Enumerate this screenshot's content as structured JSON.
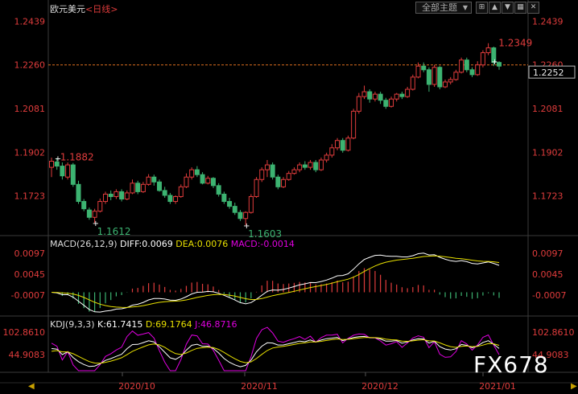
{
  "header": {
    "symbol": "欧元美元",
    "period": "<日线>"
  },
  "toolbar": {
    "indicator_select": "全部主题",
    "btn_settings": "⊞",
    "btn_up": "▲",
    "btn_down": "▼",
    "btn_grid": "▦",
    "btn_close": "✕"
  },
  "price_axis": {
    "left_labels": [
      "1.2439",
      "1.2260",
      "1.2081",
      "1.1902",
      "1.1723"
    ],
    "right_labels": [
      "1.2439",
      "1.2260",
      "1.2081",
      "1.1902",
      "1.1723"
    ],
    "current_price": "1.2252"
  },
  "annotations": {
    "high_left": "1.1882",
    "low_1": "1.1612",
    "low_2": "1.1603",
    "high_right": "1.2349"
  },
  "macd": {
    "title": "MACD(26,12,9)",
    "diff_label": "DIFF:0.0069",
    "dea_label": "DEA:0.0076",
    "macd_label": "MACD:-0.0014",
    "axis_labels": [
      "0.0097",
      "0.0045",
      "-0.0007"
    ]
  },
  "kdj": {
    "title": "KDJ(9,3,3)",
    "k_label": "K:61.7415",
    "d_label": "D:69.1764",
    "j_label": "J:46.8716",
    "axis_labels": [
      "102.8610",
      "44.9083"
    ]
  },
  "date_axis": [
    "2020/10",
    "2020/11",
    "2020/12",
    "2021/01"
  ],
  "watermark": "FX678",
  "nav": {
    "left": "◀",
    "right": "▶"
  },
  "colors": {
    "up": "#e03c3c",
    "down": "#3cb371",
    "diff": "#ffffff",
    "dea": "#e8e000",
    "macd": "#e000e0",
    "k": "#ffffff",
    "d": "#e8e000",
    "j": "#e000e0",
    "axis_text": "#e03c3c",
    "grid": "#5a1a1a"
  },
  "chart_data": {
    "type": "candlestick",
    "title": "欧元美元 <日线>",
    "ylim": [
      1.156,
      1.248
    ],
    "x_ticks": [
      "2020/10",
      "2020/11",
      "2020/12",
      "2021/01"
    ],
    "candles": [
      [
        1.184,
        1.1865,
        1.188,
        1.18
      ],
      [
        1.1862,
        1.1845,
        1.1878,
        1.183
      ],
      [
        1.1845,
        1.1805,
        1.186,
        1.179
      ],
      [
        1.18,
        1.185,
        1.186,
        1.179
      ],
      [
        1.185,
        1.177,
        1.1858,
        1.176
      ],
      [
        1.177,
        1.17,
        1.1785,
        1.169
      ],
      [
        1.17,
        1.167,
        1.171,
        1.166
      ],
      [
        1.1665,
        1.1635,
        1.1675,
        1.1625
      ],
      [
        1.1635,
        1.166,
        1.167,
        1.1612
      ],
      [
        1.166,
        1.17,
        1.1712,
        1.1655
      ],
      [
        1.17,
        1.173,
        1.174,
        1.169
      ],
      [
        1.173,
        1.172,
        1.1745,
        1.1705
      ],
      [
        1.172,
        1.174,
        1.175,
        1.171
      ],
      [
        1.174,
        1.171,
        1.175,
        1.17
      ],
      [
        1.171,
        1.1735,
        1.1745,
        1.1705
      ],
      [
        1.1735,
        1.1775,
        1.179,
        1.173
      ],
      [
        1.1775,
        1.174,
        1.1785,
        1.173
      ],
      [
        1.174,
        1.177,
        1.178,
        1.1735
      ],
      [
        1.177,
        1.18,
        1.1812,
        1.1765
      ],
      [
        1.18,
        1.178,
        1.181,
        1.1765
      ],
      [
        1.178,
        1.1745,
        1.179,
        1.174
      ],
      [
        1.1745,
        1.1725,
        1.176,
        1.1715
      ],
      [
        1.1725,
        1.17,
        1.1735,
        1.169
      ],
      [
        1.17,
        1.172,
        1.1725,
        1.169
      ],
      [
        1.172,
        1.176,
        1.177,
        1.1715
      ],
      [
        1.176,
        1.18,
        1.1815,
        1.1755
      ],
      [
        1.18,
        1.183,
        1.184,
        1.179
      ],
      [
        1.183,
        1.181,
        1.1845,
        1.18
      ],
      [
        1.181,
        1.1775,
        1.182,
        1.177
      ],
      [
        1.1775,
        1.1795,
        1.1805,
        1.177
      ],
      [
        1.1795,
        1.1765,
        1.18,
        1.1755
      ],
      [
        1.1765,
        1.173,
        1.1775,
        1.172
      ],
      [
        1.173,
        1.17,
        1.174,
        1.169
      ],
      [
        1.17,
        1.168,
        1.1715,
        1.167
      ],
      [
        1.168,
        1.1655,
        1.1695,
        1.1645
      ],
      [
        1.1655,
        1.163,
        1.1665,
        1.162
      ],
      [
        1.163,
        1.1655,
        1.166,
        1.1603
      ],
      [
        1.1655,
        1.172,
        1.173,
        1.165
      ],
      [
        1.172,
        1.179,
        1.18,
        1.1715
      ],
      [
        1.179,
        1.183,
        1.184,
        1.178
      ],
      [
        1.183,
        1.185,
        1.187,
        1.18
      ],
      [
        1.185,
        1.18,
        1.186,
        1.179
      ],
      [
        1.18,
        1.176,
        1.181,
        1.175
      ],
      [
        1.176,
        1.179,
        1.18,
        1.1755
      ],
      [
        1.179,
        1.1815,
        1.1825,
        1.1785
      ],
      [
        1.1815,
        1.183,
        1.184,
        1.181
      ],
      [
        1.183,
        1.185,
        1.186,
        1.182
      ],
      [
        1.185,
        1.184,
        1.1865,
        1.183
      ],
      [
        1.184,
        1.186,
        1.187,
        1.183
      ],
      [
        1.186,
        1.183,
        1.187,
        1.182
      ],
      [
        1.183,
        1.187,
        1.188,
        1.1825
      ],
      [
        1.187,
        1.189,
        1.19,
        1.186
      ],
      [
        1.189,
        1.192,
        1.1935,
        1.188
      ],
      [
        1.192,
        1.195,
        1.196,
        1.191
      ],
      [
        1.195,
        1.191,
        1.196,
        1.19
      ],
      [
        1.191,
        1.196,
        1.197,
        1.1905
      ],
      [
        1.196,
        1.207,
        1.208,
        1.1955
      ],
      [
        1.207,
        1.213,
        1.2145,
        1.206
      ],
      [
        1.213,
        1.215,
        1.2175,
        1.212
      ],
      [
        1.215,
        1.212,
        1.216,
        1.2105
      ],
      [
        1.212,
        1.214,
        1.215,
        1.211
      ],
      [
        1.214,
        1.2115,
        1.215,
        1.21
      ],
      [
        1.2115,
        1.209,
        1.2125,
        1.208
      ],
      [
        1.209,
        1.212,
        1.213,
        1.2085
      ],
      [
        1.212,
        1.214,
        1.2145,
        1.211
      ],
      [
        1.214,
        1.213,
        1.215,
        1.212
      ],
      [
        1.213,
        1.216,
        1.217,
        1.2125
      ],
      [
        1.216,
        1.221,
        1.222,
        1.2155
      ],
      [
        1.221,
        1.2255,
        1.227,
        1.2205
      ],
      [
        1.2255,
        1.224,
        1.227,
        1.223
      ],
      [
        1.224,
        1.218,
        1.225,
        1.215
      ],
      [
        1.218,
        1.225,
        1.226,
        1.217
      ],
      [
        1.225,
        1.217,
        1.2255,
        1.216
      ],
      [
        1.217,
        1.219,
        1.22,
        1.2165
      ],
      [
        1.219,
        1.22,
        1.221,
        1.218
      ],
      [
        1.22,
        1.223,
        1.224,
        1.2195
      ],
      [
        1.223,
        1.228,
        1.229,
        1.2225
      ],
      [
        1.228,
        1.224,
        1.229,
        1.223
      ],
      [
        1.224,
        1.222,
        1.225,
        1.221
      ],
      [
        1.222,
        1.226,
        1.2275,
        1.2215
      ],
      [
        1.226,
        1.231,
        1.232,
        1.225
      ],
      [
        1.231,
        1.233,
        1.2349,
        1.23
      ],
      [
        1.233,
        1.227,
        1.2335,
        1.2255
      ],
      [
        1.227,
        1.2255,
        1.2275,
        1.224
      ]
    ]
  }
}
